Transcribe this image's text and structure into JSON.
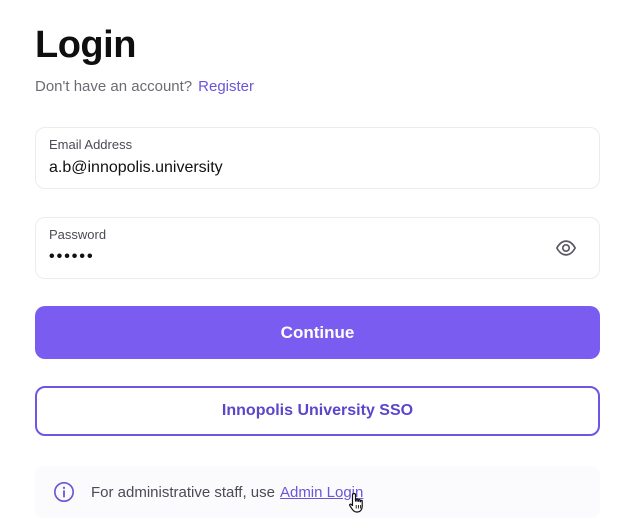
{
  "header": {
    "title": "Login",
    "subtitle": "Don't have an account?",
    "register_link": "Register"
  },
  "form": {
    "email": {
      "label": "Email Address",
      "value": "a.b@innopolis.university"
    },
    "password": {
      "label": "Password",
      "value": "••••••",
      "toggle_icon": "eye-icon"
    },
    "continue_label": "Continue",
    "sso_label": "Innopolis University SSO"
  },
  "admin": {
    "text": "For administrative staff, use",
    "link": "Admin Login",
    "icon": "info-icon"
  },
  "colors": {
    "accent": "#7b5cf0",
    "link": "#6c55d9",
    "sso_border": "#6f55e3"
  }
}
